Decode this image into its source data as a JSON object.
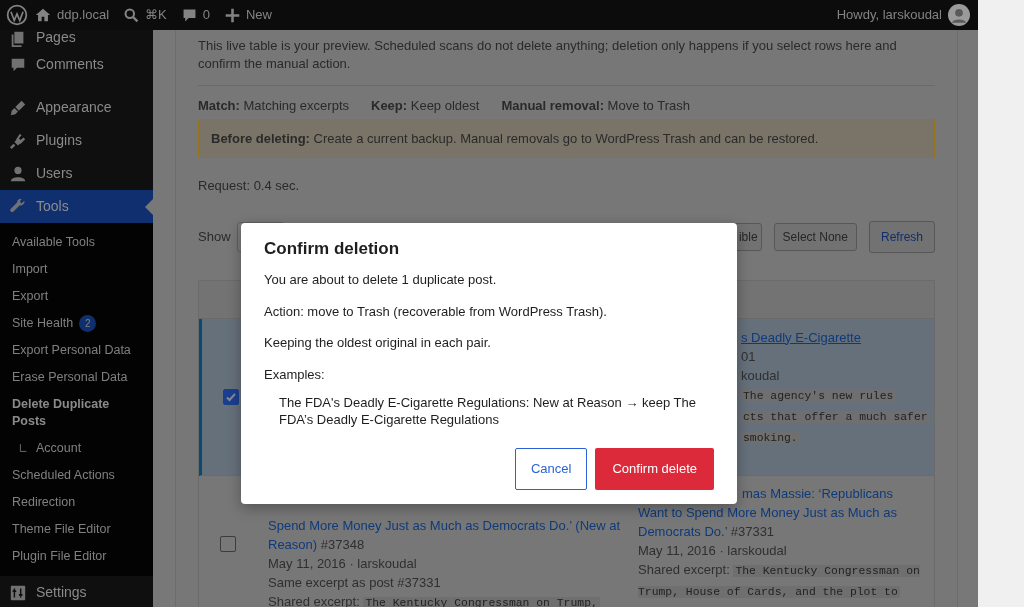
{
  "admin_bar": {
    "site": "ddp.local",
    "shortcut": "⌘K",
    "comments": "0",
    "new": "New",
    "greeting": "Howdy, larskoudal"
  },
  "sidebar": {
    "items": [
      {
        "label": "Pages",
        "selected": false
      },
      {
        "label": "Comments",
        "selected": false
      },
      {
        "label": "Appearance",
        "selected": false
      },
      {
        "label": "Plugins",
        "selected": false
      },
      {
        "label": "Users",
        "selected": false
      },
      {
        "label": "Tools",
        "selected": true,
        "children": [
          {
            "label": "Available Tools",
            "selected": false
          },
          {
            "label": "Import",
            "selected": false
          },
          {
            "label": "Export",
            "selected": false
          },
          {
            "label": "Site Health",
            "selected": false,
            "badge": "2"
          },
          {
            "label": "Export Personal Data",
            "selected": false
          },
          {
            "label": "Erase Personal Data",
            "selected": false
          },
          {
            "label": "Delete Duplicate Posts",
            "selected": true,
            "children": [
              {
                "label": "Account",
                "selected": false
              }
            ]
          },
          {
            "label": "Scheduled Actions",
            "selected": false
          },
          {
            "label": "Redirection",
            "selected": false
          },
          {
            "label": "Theme File Editor",
            "selected": false
          },
          {
            "label": "Plugin File Editor",
            "selected": false
          }
        ]
      },
      {
        "label": "Settings",
        "selected": false
      }
    ]
  },
  "intro": "This live table is your preview. Scheduled scans do not delete anything; deletion only happens if you select rows here and confirm the manual action.",
  "settings": [
    {
      "label": "Match:",
      "value": "Matching excerpts"
    },
    {
      "label": "Keep:",
      "value": "Keep oldest"
    },
    {
      "label": "Manual removal:",
      "value": "Move to Trash"
    }
  ],
  "notice": "**Before deleting:** Create a current backup. Manual removals go to WordPress Trash and can be restored.",
  "request": "Request: 0.4 sec.",
  "toolbar": {
    "show_label": "Show",
    "buttons": [
      {
        "label": "ible",
        "kind": "plain"
      },
      {
        "label": "Select None",
        "kind": "plain"
      },
      {
        "label": "Refresh",
        "kind": "accent"
      }
    ]
  },
  "table": {
    "rows": [
      {
        "checked": true,
        "selected": true,
        "duplicate": [],
        "original": [
          {
            "kind": "link",
            "text": "s Deadly E-Cigarette"
          },
          {
            "kind": "meta",
            "text": "01"
          },
          {
            "kind": "meta",
            "text": "koudal"
          },
          {
            "kind": "code",
            "text": "The agency's new rules"
          },
          {
            "kind": "code",
            "text": "cts that offer a much safer"
          },
          {
            "kind": "code",
            "text": "smoking."
          }
        ]
      },
      {
        "checked": false,
        "selected": false,
        "duplicate": [
          {
            "kind": "title",
            "text": "Spend More Money Just as Much as Democrats Do.’ (New at Reason)",
            "id": "#37348"
          },
          {
            "kind": "meta",
            "text": "May 11, 2016 · larskoudal"
          },
          {
            "kind": "meta",
            "text": "Same excerpt as post #37331"
          },
          {
            "kind": "excerpt",
            "label": "Shared excerpt:",
            "text": "The Kentucky Congressman on Trump,"
          }
        ],
        "original": [
          {
            "kind": "title",
            "text": "mas Massie: ‘Republicans Want to Spend More Money Just as Much as Democrats Do.’",
            "id": "#37331"
          },
          {
            "kind": "meta",
            "text": "May 11, 2016 · larskoudal"
          },
          {
            "kind": "excerpt",
            "label": "Shared excerpt:",
            "text": "The Kentucky Congressman on Trump, House of Cards, and the plot to"
          }
        ]
      }
    ]
  },
  "modal": {
    "title": "Confirm deletion",
    "paragraphs": [
      "You are about to delete 1 duplicate post.",
      "Action: move to Trash (recoverable from WordPress Trash).",
      "Keeping the oldest original in each pair.",
      "Examples:"
    ],
    "examples": [
      "The FDA's Deadly E-Cigarette Regulations: New at Reason → keep The FDA’s Deadly E-Cigarette Regulations"
    ],
    "cancel": "Cancel",
    "confirm": "Confirm delete"
  }
}
